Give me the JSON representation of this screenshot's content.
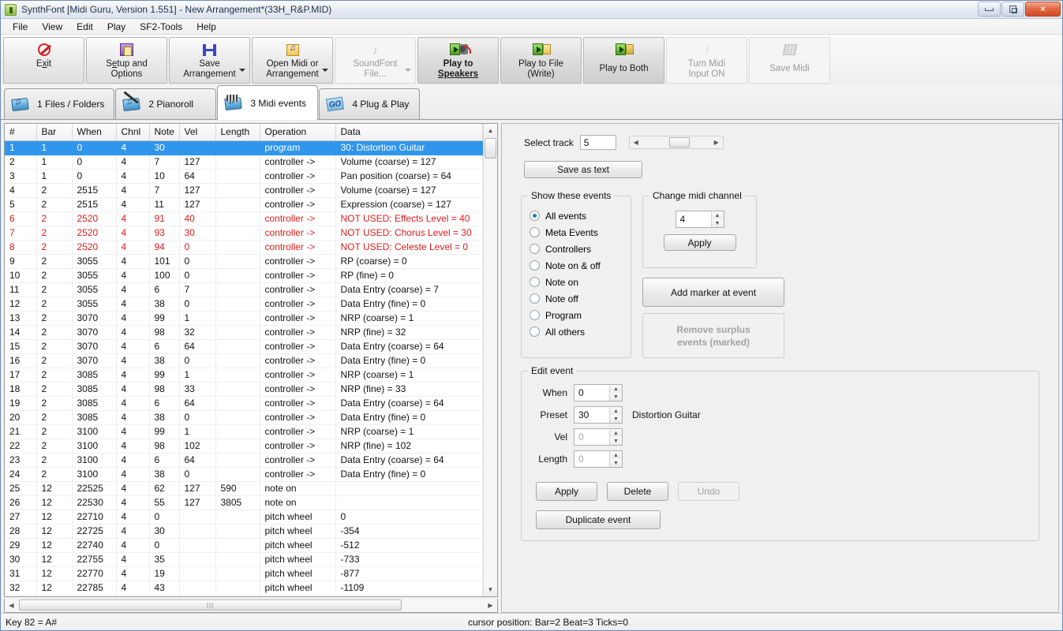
{
  "window": {
    "title": "SynthFont [Midi Guru, Version 1.551] - New Arrangement*(33H_R&P.MID)",
    "icon": "synthfont-logo-icon",
    "minimize": "minimize-icon",
    "restore": "restore-icon",
    "close": "×"
  },
  "menu": [
    {
      "label": "File"
    },
    {
      "label": "View"
    },
    {
      "label": "Edit"
    },
    {
      "label": "Play"
    },
    {
      "label": "SF2-Tools"
    },
    {
      "label": "Help"
    }
  ],
  "toolbar": [
    {
      "id": "exit",
      "line1": "E",
      "u": "x",
      "line2": "it",
      "two_line": false,
      "icon": "exit-icon",
      "disabled": false,
      "bold": false,
      "dropdown": false
    },
    {
      "id": "setup",
      "line1": "S",
      "u": "e",
      "line2": "tup and",
      "line3": "Options",
      "icon": "setup-options-icon",
      "disabled": false,
      "bold": false,
      "dropdown": false
    },
    {
      "id": "save-arrangement",
      "line1": "Save",
      "line2": "Arrangement",
      "icon": "save-icon",
      "disabled": false,
      "bold": false,
      "dropdown": true
    },
    {
      "id": "open-midi",
      "line1": "Open Midi or",
      "line2": "Arrangement",
      "icon": "open-midi-icon",
      "disabled": false,
      "bold": false,
      "dropdown": true
    },
    {
      "id": "soundfont",
      "line1": "SoundFont",
      "line2": "File...",
      "icon": "soundfont-icon",
      "disabled": true,
      "bold": false,
      "dropdown": true
    },
    {
      "id": "play-speakers",
      "line1": "Play to",
      "line2": "Speakers",
      "icon": "play-speakers-icon",
      "disabled": false,
      "bold": true,
      "dropdown": false
    },
    {
      "id": "play-file",
      "line1": "Play to File",
      "line2": "(Write)",
      "icon": "play-to-file-icon",
      "disabled": false,
      "bold": false,
      "dropdown": false
    },
    {
      "id": "play-both",
      "line1": "Play to Both",
      "line2": "",
      "icon": "play-to-both-icon",
      "disabled": false,
      "bold": false,
      "dropdown": false
    },
    {
      "id": "midi-input",
      "line1": "Turn Midi",
      "line2": "Input ON",
      "icon": "midi-input-icon",
      "disabled": true,
      "bold": false,
      "dropdown": false
    },
    {
      "id": "save-midi",
      "line1": "Save Midi",
      "line2": "",
      "icon": "save-midi-icon",
      "disabled": true,
      "bold": false,
      "dropdown": false
    }
  ],
  "tabs": [
    {
      "label": "1 Files / Folders",
      "icon": "files-folders-icon",
      "selected": false
    },
    {
      "label": "2 Pianoroll",
      "icon": "pianoroll-icon",
      "selected": false
    },
    {
      "label": "3 Midi events",
      "icon": "midi-events-icon",
      "selected": true
    },
    {
      "label": "4 Plug & Play",
      "icon": "plug-and-play-icon",
      "selected": false
    }
  ],
  "grid": {
    "columns": [
      "#",
      "Bar",
      "When",
      "Chnl",
      "Note",
      "Vel",
      "Length",
      "Operation",
      "Data"
    ],
    "rows": [
      {
        "cells": [
          "1",
          "1",
          "0",
          "4",
          "30",
          "",
          "",
          "program",
          "30: Distortion Guitar"
        ],
        "state": "selected"
      },
      {
        "cells": [
          "2",
          "1",
          "0",
          "4",
          "7",
          "127",
          "",
          "controller ->",
          "Volume (coarse) = 127"
        ],
        "state": "normal"
      },
      {
        "cells": [
          "3",
          "1",
          "0",
          "4",
          "10",
          "64",
          "",
          "controller ->",
          "Pan position (coarse) = 64"
        ],
        "state": "normal"
      },
      {
        "cells": [
          "4",
          "2",
          "2515",
          "4",
          "7",
          "127",
          "",
          "controller ->",
          "Volume (coarse) = 127"
        ],
        "state": "normal"
      },
      {
        "cells": [
          "5",
          "2",
          "2515",
          "4",
          "11",
          "127",
          "",
          "controller ->",
          "Expression (coarse) = 127"
        ],
        "state": "normal"
      },
      {
        "cells": [
          "6",
          "2",
          "2520",
          "4",
          "91",
          "40",
          "",
          "controller ->",
          "NOT USED: Effects Level = 40"
        ],
        "state": "red"
      },
      {
        "cells": [
          "7",
          "2",
          "2520",
          "4",
          "93",
          "30",
          "",
          "controller ->",
          "NOT USED: Chorus Level = 30"
        ],
        "state": "red"
      },
      {
        "cells": [
          "8",
          "2",
          "2520",
          "4",
          "94",
          "0",
          "",
          "controller ->",
          "NOT USED: Celeste Level = 0"
        ],
        "state": "red"
      },
      {
        "cells": [
          "9",
          "2",
          "3055",
          "4",
          "101",
          "0",
          "",
          "controller ->",
          "RP (coarse) = 0"
        ],
        "state": "normal"
      },
      {
        "cells": [
          "10",
          "2",
          "3055",
          "4",
          "100",
          "0",
          "",
          "controller ->",
          "RP (fine) = 0"
        ],
        "state": "normal"
      },
      {
        "cells": [
          "11",
          "2",
          "3055",
          "4",
          "6",
          "7",
          "",
          "controller ->",
          "Data Entry (coarse) = 7"
        ],
        "state": "normal"
      },
      {
        "cells": [
          "12",
          "2",
          "3055",
          "4",
          "38",
          "0",
          "",
          "controller ->",
          "Data Entry (fine) = 0"
        ],
        "state": "normal"
      },
      {
        "cells": [
          "13",
          "2",
          "3070",
          "4",
          "99",
          "1",
          "",
          "controller ->",
          "NRP (coarse) = 1"
        ],
        "state": "normal"
      },
      {
        "cells": [
          "14",
          "2",
          "3070",
          "4",
          "98",
          "32",
          "",
          "controller ->",
          "NRP (fine) = 32"
        ],
        "state": "normal"
      },
      {
        "cells": [
          "15",
          "2",
          "3070",
          "4",
          "6",
          "64",
          "",
          "controller ->",
          "Data Entry (coarse) = 64"
        ],
        "state": "normal"
      },
      {
        "cells": [
          "16",
          "2",
          "3070",
          "4",
          "38",
          "0",
          "",
          "controller ->",
          "Data Entry (fine) = 0"
        ],
        "state": "normal"
      },
      {
        "cells": [
          "17",
          "2",
          "3085",
          "4",
          "99",
          "1",
          "",
          "controller ->",
          "NRP (coarse) = 1"
        ],
        "state": "normal"
      },
      {
        "cells": [
          "18",
          "2",
          "3085",
          "4",
          "98",
          "33",
          "",
          "controller ->",
          "NRP (fine) = 33"
        ],
        "state": "normal"
      },
      {
        "cells": [
          "19",
          "2",
          "3085",
          "4",
          "6",
          "64",
          "",
          "controller ->",
          "Data Entry (coarse) = 64"
        ],
        "state": "normal"
      },
      {
        "cells": [
          "20",
          "2",
          "3085",
          "4",
          "38",
          "0",
          "",
          "controller ->",
          "Data Entry (fine) = 0"
        ],
        "state": "normal"
      },
      {
        "cells": [
          "21",
          "2",
          "3100",
          "4",
          "99",
          "1",
          "",
          "controller ->",
          "NRP (coarse) = 1"
        ],
        "state": "normal"
      },
      {
        "cells": [
          "22",
          "2",
          "3100",
          "4",
          "98",
          "102",
          "",
          "controller ->",
          "NRP (fine) = 102"
        ],
        "state": "normal"
      },
      {
        "cells": [
          "23",
          "2",
          "3100",
          "4",
          "6",
          "64",
          "",
          "controller ->",
          "Data Entry (coarse) = 64"
        ],
        "state": "normal"
      },
      {
        "cells": [
          "24",
          "2",
          "3100",
          "4",
          "38",
          "0",
          "",
          "controller ->",
          "Data Entry (fine) = 0"
        ],
        "state": "normal"
      },
      {
        "cells": [
          "25",
          "12",
          "22525",
          "4",
          "62",
          "127",
          "590",
          "note on",
          ""
        ],
        "state": "normal"
      },
      {
        "cells": [
          "26",
          "12",
          "22530",
          "4",
          "55",
          "127",
          "3805",
          "note on",
          ""
        ],
        "state": "normal"
      },
      {
        "cells": [
          "27",
          "12",
          "22710",
          "4",
          "0",
          "",
          "",
          "pitch wheel",
          "0"
        ],
        "state": "normal"
      },
      {
        "cells": [
          "28",
          "12",
          "22725",
          "4",
          "30",
          "",
          "",
          "pitch wheel",
          "-354"
        ],
        "state": "normal"
      },
      {
        "cells": [
          "29",
          "12",
          "22740",
          "4",
          "0",
          "",
          "",
          "pitch wheel",
          "-512"
        ],
        "state": "normal"
      },
      {
        "cells": [
          "30",
          "12",
          "22755",
          "4",
          "35",
          "",
          "",
          "pitch wheel",
          "-733"
        ],
        "state": "normal"
      },
      {
        "cells": [
          "31",
          "12",
          "22770",
          "4",
          "19",
          "",
          "",
          "pitch wheel",
          "-877"
        ],
        "state": "normal"
      },
      {
        "cells": [
          "32",
          "12",
          "22785",
          "4",
          "43",
          "",
          "",
          "pitch wheel",
          "-1109"
        ],
        "state": "normal"
      }
    ]
  },
  "panel": {
    "select_track_label": "Select track",
    "select_track_value": "5",
    "save_as_text": "Save as text",
    "show_events": {
      "legend": "Show these events",
      "options": [
        {
          "label": "All events",
          "selected": true
        },
        {
          "label": "Meta Events",
          "selected": false
        },
        {
          "label": "Controllers",
          "selected": false
        },
        {
          "label": "Note on & off",
          "selected": false
        },
        {
          "label": "Note on",
          "selected": false
        },
        {
          "label": "Note off",
          "selected": false
        },
        {
          "label": "Program",
          "selected": false
        },
        {
          "label": "All others",
          "selected": false
        }
      ]
    },
    "change_channel": {
      "legend": "Change midi channel",
      "value": "4",
      "apply_label": "Apply"
    },
    "add_marker_label": "Add marker at event",
    "remove_surplus_line1": "Remove surplus",
    "remove_surplus_line2": "events (marked)",
    "edit_event": {
      "legend": "Edit event",
      "when_label": "When",
      "when_value": "0",
      "preset_label": "Preset",
      "preset_value": "30",
      "preset_name": "Distortion Guitar",
      "vel_label": "Vel",
      "vel_value": "0",
      "length_label": "Length",
      "length_value": "0",
      "apply_label": "Apply",
      "delete_label": "Delete",
      "undo_label": "Undo",
      "duplicate_label": "Duplicate event"
    }
  },
  "statusbar": {
    "key": "Key 82 = A#",
    "cursor": "cursor position: Bar=2 Beat=3 Ticks=0"
  }
}
